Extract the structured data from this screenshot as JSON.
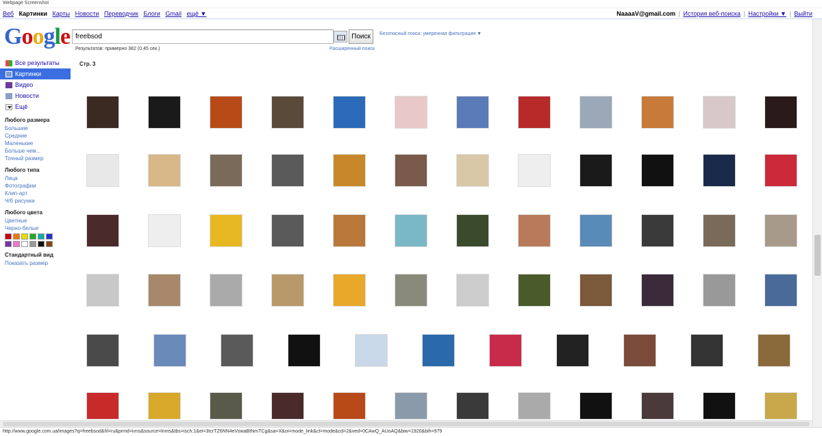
{
  "window": {
    "title": "Webpage Screenshot"
  },
  "topbar": {
    "links": [
      "Веб",
      "Картинки",
      "Карты",
      "Новости",
      "Переводчик",
      "Блоги",
      "Gmail",
      "ещё ▼"
    ],
    "current": "Картинки",
    "email": "NaaaaV@gmail.com",
    "history": "История веб-поиска",
    "settings": "Настройки ▼",
    "signout": "Выйти"
  },
  "logo": {
    "text": "Google"
  },
  "search": {
    "value": "freebsod",
    "button": "Поиск",
    "safesearch": "Безопасный поиск: умеренная фильтрация ▼"
  },
  "results": {
    "stats": "Результатов: примерно 382 (0,45 сек.)",
    "advanced": "Расширенный поиск",
    "page": "Стр. 3"
  },
  "leftnav": {
    "items": [
      {
        "label": "Все результаты",
        "icon": "all-results-icon"
      },
      {
        "label": "Картинки",
        "icon": "images-icon"
      },
      {
        "label": "Видео",
        "icon": "video-icon"
      },
      {
        "label": "Новости",
        "icon": "news-icon"
      },
      {
        "label": "Ещё",
        "icon": "more-icon"
      }
    ],
    "size_heading": "Любого размера",
    "sizes": [
      "Большие",
      "Средние",
      "Маленькие",
      "Больше чем...",
      "Точный размер"
    ],
    "type_heading": "Любого типа",
    "types": [
      "Лица",
      "Фотографии",
      "Клип-арт",
      "Ч/б рисунки"
    ],
    "color_heading": "Любого цвета",
    "colors": [
      "Цветные",
      "Черно-белые"
    ],
    "swatches": [
      "#cc0000",
      "#ee7700",
      "#eedd00",
      "#22aa22",
      "#11aaaa",
      "#2233cc",
      "#7733aa",
      "#ee77cc",
      "#ffffff",
      "#999999",
      "#111111",
      "#884411"
    ],
    "view_heading": "Стандартный вид",
    "view_link": "Показать размер"
  },
  "thumb_colors": [
    [
      "#3a2a22",
      "#1a1a1a",
      "#b84a1a",
      "#5a4a3a",
      "#2a6ab8",
      "#e8c8c8",
      "#5a7ab8",
      "#b82a2a",
      "#9aa8b8",
      "#c87a3a",
      "#d8c8c8",
      "#2a1a1a"
    ],
    [
      "#e8e8e8",
      "#d8b888",
      "#7a6a5a",
      "#5a5a5a",
      "#c8882a",
      "#7a5a4a",
      "#d8c8a8",
      "#eeeeee",
      "#1a1a1a",
      "#111111",
      "#1a2a4a",
      "#cc2a3a"
    ],
    [
      "#4a2a2a",
      "#eeeeee",
      "#e8b822",
      "#5a5a5a",
      "#b8783a",
      "#7ab8c8",
      "#3a4a2a",
      "#b87a5a",
      "#5a8ab8",
      "#3a3a3a",
      "#7a6a5a",
      "#a89a8a"
    ],
    [
      "#c8c8c8",
      "#a8886a",
      "#aaaaaa",
      "#b89a6a",
      "#e8a82a",
      "#8a8a7a",
      "#cccccc",
      "#4a5a2a",
      "#7a5a3a",
      "#3a2a3a",
      "#999999",
      "#4a6a9a"
    ],
    [
      "#4a4a4a",
      "#6a8aba",
      "#5a5a5a",
      "#111111",
      "#c8d8e8",
      "#2a6aaa",
      "#c82a4a",
      "#222222",
      "#7a4a3a",
      "#333333",
      "#8a6a3a"
    ],
    [
      "#c82a2a",
      "#d8a82a",
      "#5a5a4a",
      "#4a2a2a",
      "#b84a1a",
      "#8a9aaa",
      "#3a3a3a",
      "#aaaaaa",
      "#111111",
      "#4a3a3a",
      "#111111",
      "#c8a84a"
    ]
  ],
  "statusbar": {
    "url": "http://www.google.com.ua/images?q=freebsod&hl=ru&prmd=ivns&source=lnms&tbs=isch:1&ei=3tcrTZ6NN4eVswaBtNmTCg&sa=X&oi=mode_link&ct=mode&cd=2&ved=0CAwQ_AUoAQ&biw=1920&bih=979"
  }
}
